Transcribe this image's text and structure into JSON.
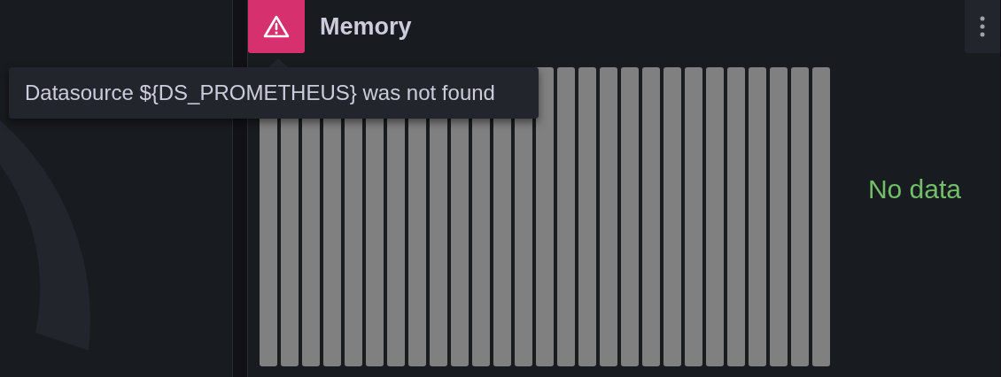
{
  "panel": {
    "title": "Memory",
    "error": true,
    "tooltip": "Datasource ${DS_PROMETHEUS} was not found",
    "message": "No data"
  }
}
